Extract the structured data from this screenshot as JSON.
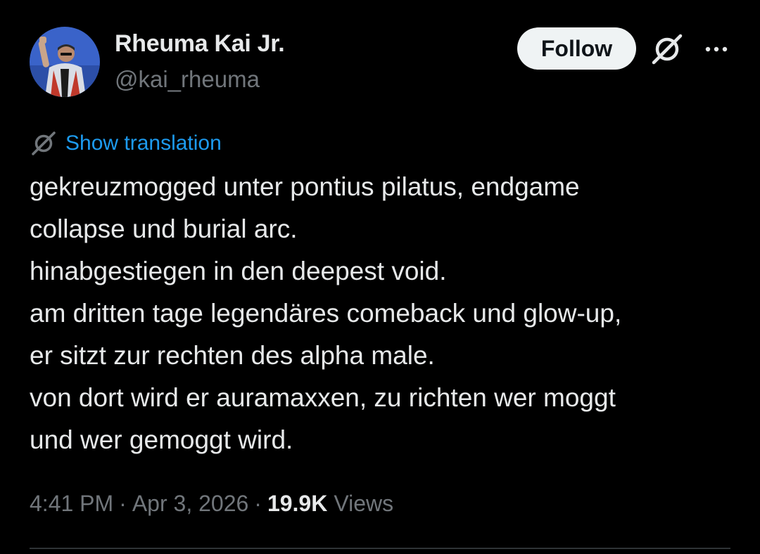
{
  "author": {
    "display_name": "Rheuma Kai Jr.",
    "handle": "@kai_rheuma",
    "avatar_icon": "profile-photo"
  },
  "actions": {
    "follow_label": "Follow",
    "translate_icon": "grok-translate-icon",
    "more_icon": "more-horizontal-icon"
  },
  "translation": {
    "label": "Show translation",
    "icon": "translate-icon",
    "link_color": "#1d9bf0"
  },
  "tweet": {
    "lines": [
      "gekreuzmogged unter pontius pilatus, endgame",
      "collapse und burial arc.",
      "hinabgestiegen in den deepest void.",
      "am dritten tage legendäres comeback und glow-up,",
      "er sitzt zur rechten des alpha male.",
      "von dort wird er auramaxxen, zu richten wer moggt",
      "und wer gemoggt wird."
    ]
  },
  "meta": {
    "time": "4:41 PM",
    "date": "Apr 3, 2026",
    "separator": "·",
    "views_count": "19.9K",
    "views_label": "Views"
  },
  "colors": {
    "background": "#000000",
    "text_primary": "#e7e9ea",
    "text_secondary": "#71767b",
    "follow_bg": "#eff3f4",
    "divider": "#2f3336"
  }
}
